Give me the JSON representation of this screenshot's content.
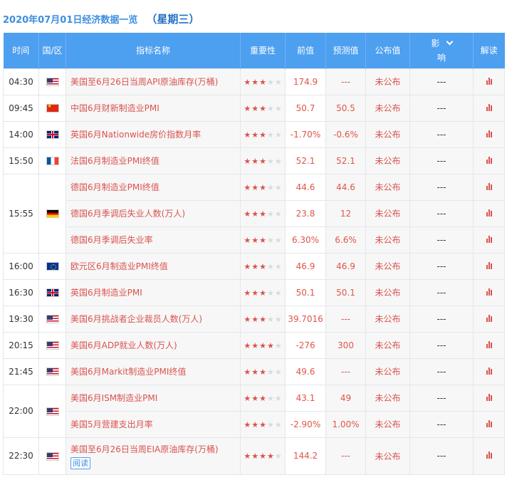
{
  "heading": {
    "date": "2020年07月01日经济数据一览",
    "weekday": "（星期三）"
  },
  "columns": {
    "time": "时间",
    "region": "国/区",
    "name": "指标名称",
    "importance": "重要性",
    "previous": "前值",
    "forecast": "预测值",
    "published": "公布值",
    "impact_top": "影",
    "impact_bottom": "响",
    "analysis": "解读"
  },
  "colors": {
    "header_bg": "#4d9ff0",
    "accent_red": "#d9534f",
    "link_blue": "#3d8ee0"
  },
  "groups": [
    {
      "time": "04:30",
      "flag": "flag-us",
      "rows": [
        {
          "name": "美国至6月26日当周API原油库存(万桶)",
          "stars": 3,
          "previous": "174.9",
          "forecast": "---",
          "published": "未公布",
          "impact": "---"
        }
      ]
    },
    {
      "time": "09:45",
      "flag": "flag-cn",
      "rows": [
        {
          "name": "中国6月财新制造业PMI",
          "stars": 3,
          "previous": "50.7",
          "forecast": "50.5",
          "published": "未公布",
          "impact": "---"
        }
      ]
    },
    {
      "time": "14:00",
      "flag": "flag-gb",
      "rows": [
        {
          "name": "英国6月Nationwide房价指数月率",
          "stars": 3,
          "previous": "-1.70%",
          "forecast": "-0.6%",
          "published": "未公布",
          "impact": "---"
        }
      ]
    },
    {
      "time": "15:50",
      "flag": "flag-fr",
      "rows": [
        {
          "name": "法国6月制造业PMI终值",
          "stars": 3,
          "previous": "52.1",
          "forecast": "52.1",
          "published": "未公布",
          "impact": "---"
        }
      ]
    },
    {
      "time": "15:55",
      "flag": "flag-de",
      "rows": [
        {
          "name": "德国6月制造业PMI终值",
          "stars": 3,
          "previous": "44.6",
          "forecast": "44.6",
          "published": "未公布",
          "impact": "---"
        },
        {
          "name": "德国6月季调后失业人数(万人)",
          "stars": 3,
          "previous": "23.8",
          "forecast": "12",
          "published": "未公布",
          "impact": "---"
        },
        {
          "name": "德国6月季调后失业率",
          "stars": 3,
          "previous": "6.30%",
          "forecast": "6.6%",
          "published": "未公布",
          "impact": "---"
        }
      ]
    },
    {
      "time": "16:00",
      "flag": "flag-eu",
      "rows": [
        {
          "name": "欧元区6月制造业PMI终值",
          "stars": 3,
          "previous": "46.9",
          "forecast": "46.9",
          "published": "未公布",
          "impact": "---"
        }
      ]
    },
    {
      "time": "16:30",
      "flag": "flag-gb",
      "rows": [
        {
          "name": "英国6月制造业PMI",
          "stars": 3,
          "previous": "50.1",
          "forecast": "50.1",
          "published": "未公布",
          "impact": "---"
        }
      ]
    },
    {
      "time": "19:30",
      "flag": "flag-us",
      "rows": [
        {
          "name": "美国6月挑战者企业裁员人数(万人)",
          "stars": 3,
          "previous": "39.7016",
          "forecast": "---",
          "published": "未公布",
          "impact": "---"
        }
      ]
    },
    {
      "time": "20:15",
      "flag": "flag-us",
      "rows": [
        {
          "name": "美国6月ADP就业人数(万人)",
          "stars": 4,
          "previous": "-276",
          "forecast": "300",
          "published": "未公布",
          "impact": "---"
        }
      ]
    },
    {
      "time": "21:45",
      "flag": "flag-us",
      "rows": [
        {
          "name": "美国6月Markit制造业PMI终值",
          "stars": 3,
          "previous": "49.6",
          "forecast": "---",
          "published": "未公布",
          "impact": "---"
        }
      ]
    },
    {
      "time": "22:00",
      "flag": "flag-us",
      "rows": [
        {
          "name": "美国6月ISM制造业PMI",
          "stars": 3,
          "previous": "43.1",
          "forecast": "49",
          "published": "未公布",
          "impact": "---"
        },
        {
          "name": "美国5月营建支出月率",
          "stars": 3,
          "previous": "-2.90%",
          "forecast": "1.00%",
          "published": "未公布",
          "impact": "---"
        }
      ]
    },
    {
      "time": "22:30",
      "flag": "flag-us",
      "tall": true,
      "rows": [
        {
          "name": "美国至6月26日当周EIA原油库存(万桶)",
          "read": "阅读",
          "stars": 4,
          "previous": "144.2",
          "forecast": "---",
          "published": "未公布",
          "impact": "---"
        }
      ]
    }
  ]
}
